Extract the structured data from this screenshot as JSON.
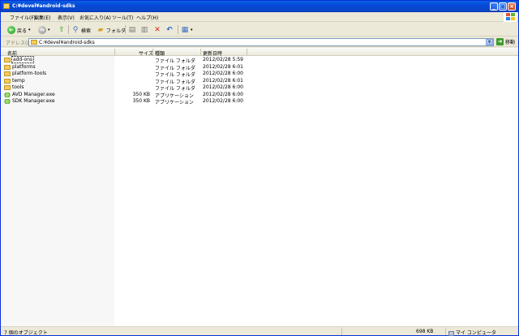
{
  "window": {
    "title": "C:¥devel¥android-sdks"
  },
  "menu": [
    "ファイル(F)",
    "編集(E)",
    "表示(V)",
    "お気に入り(A)",
    "ツール(T)",
    "ヘルプ(H)"
  ],
  "toolbar": {
    "back_label": "戻る",
    "search_label": "検索",
    "folders_label": "フォルダ"
  },
  "address": {
    "label": "アドレス(D)",
    "path": "C:¥devel¥android-sdks",
    "go_label": "移動"
  },
  "columns": {
    "name": "名前",
    "size": "サイズ",
    "type": "種類",
    "date": "更新日時"
  },
  "files": [
    {
      "name": "add-ons",
      "size": "",
      "type": "ファイル フォルダ",
      "date": "2012/02/28 5:59",
      "icon": "folder-icon"
    },
    {
      "name": "platforms",
      "size": "",
      "type": "ファイル フォルダ",
      "date": "2012/02/28 6:01",
      "icon": "folder-icon"
    },
    {
      "name": "platform-tools",
      "size": "",
      "type": "ファイル フォルダ",
      "date": "2012/02/28 6:00",
      "icon": "folder-icon"
    },
    {
      "name": "temp",
      "size": "",
      "type": "ファイル フォルダ",
      "date": "2012/02/28 6:01",
      "icon": "folder-icon"
    },
    {
      "name": "tools",
      "size": "",
      "type": "ファイル フォルダ",
      "date": "2012/02/28 6:00",
      "icon": "folder-icon"
    },
    {
      "name": "AVD Manager.exe",
      "size": "350 KB",
      "type": "アプリケーション",
      "date": "2012/02/28 6:00",
      "icon": "android-exe-icon"
    },
    {
      "name": "SDK Manager.exe",
      "size": "350 KB",
      "type": "アプリケーション",
      "date": "2012/02/28 6:00",
      "icon": "android-exe-icon"
    }
  ],
  "status": {
    "objects": "7 個のオブジェクト",
    "size": "698 KB",
    "location": "マイ コンピュータ"
  },
  "colors": {
    "titlebar": "#0a5fe0",
    "chrome": "#ece9d8",
    "selection_outline": "#000000"
  }
}
